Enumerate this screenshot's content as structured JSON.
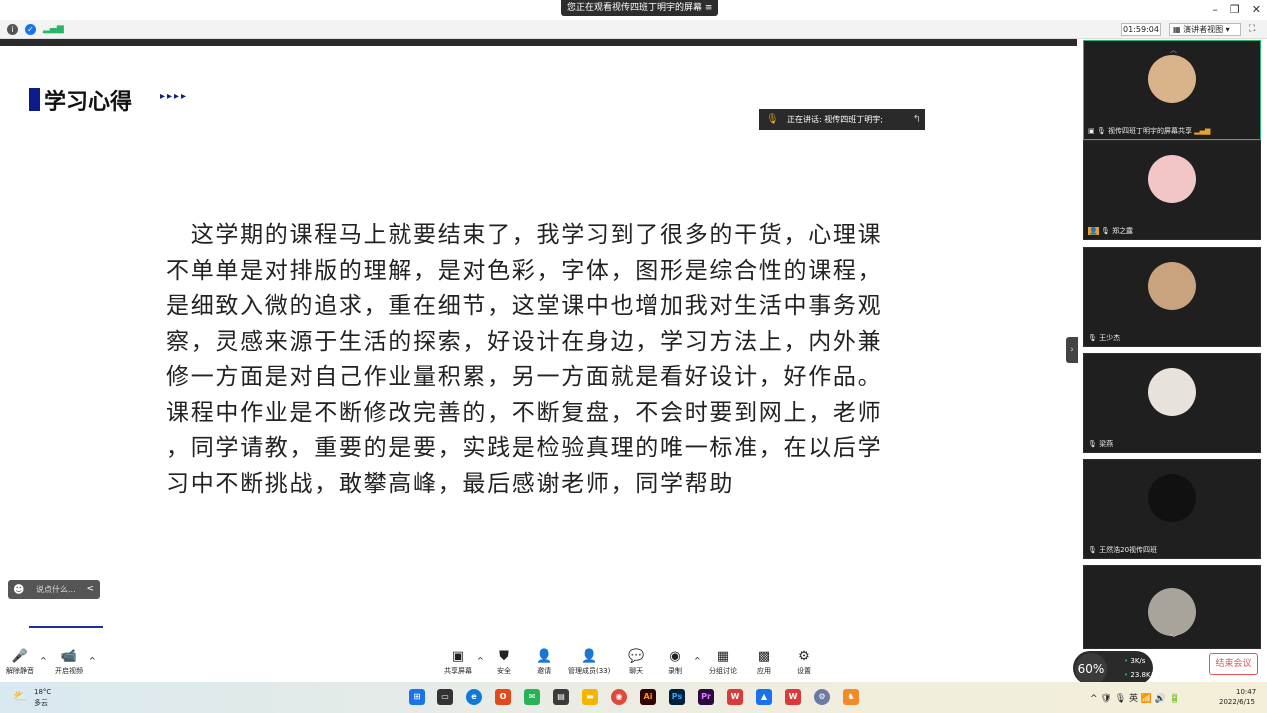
{
  "window": {
    "share_banner": "您正在观看视传四班丁明宇的屏幕",
    "share_banner_icon": "≡",
    "controls": [
      "–",
      "❐",
      "✕"
    ]
  },
  "statusbar": {
    "timer": "01:59:04",
    "view_button": "演讲者视图 ▾"
  },
  "slide": {
    "title": "学习心得",
    "title_arrows": "▸▸▸▸",
    "paragraph_lines": [
      "　这学期的课程马上就要结束了，我学习到了很多的干货，心理课",
      "不单单是对排版的理解，是对色彩，字体，图形是综合性的课程，",
      "是细致入微的追求，重在细节，这堂课中也增加我对生活中事务观",
      "察，灵感来源于生活的探索，好设计在身边，学习方法上，内外兼",
      "修一方面是对自己作业量积累，另一方面就是看好设计，好作品。",
      "课程中作业是不断修改完善的，不断复盘，不会时要到网上，老师",
      "，同学请教，重要的是要，实践是检验真理的唯一标准，在以后学",
      "习中不断挑战，敢攀高峰，最后感谢老师，同学帮助"
    ]
  },
  "speaking": {
    "label": "正在讲话: 视传四班丁明宇;"
  },
  "comment": {
    "placeholder": "说点什么...",
    "collapse": "<"
  },
  "participants": [
    {
      "name": "视传四班丁明宇的屏幕共享",
      "color": "#d9b48a",
      "active": true
    },
    {
      "name": "郑之露",
      "color": "#f2c6c6",
      "active": false
    },
    {
      "name": "王少杰",
      "color": "#c9a27e",
      "active": false
    },
    {
      "name": "梁燕",
      "color": "#e7e2dc",
      "active": false
    },
    {
      "name": "王然浩20视传四班",
      "color": "#111111",
      "active": false
    },
    {
      "name": "",
      "color": "#a9a49b",
      "active": false
    }
  ],
  "toolbar": {
    "left": [
      {
        "label": "解除静音",
        "icon": "🎤"
      },
      {
        "label": "开启视频",
        "icon": "📹"
      }
    ],
    "center": [
      {
        "label": "共享屏幕",
        "icon": "▣"
      },
      {
        "label": "安全",
        "icon": "⛊"
      },
      {
        "label": "邀请",
        "icon": "👤"
      },
      {
        "label": "管理成员(33)",
        "icon": "👤"
      },
      {
        "label": "聊天",
        "icon": "💬"
      },
      {
        "label": "录制",
        "icon": "◉"
      },
      {
        "label": "分组讨论",
        "icon": "▦"
      },
      {
        "label": "应用",
        "icon": "▩"
      },
      {
        "label": "设置",
        "icon": "⚙"
      }
    ],
    "end_meeting": "结束会议"
  },
  "network": {
    "percent": "60%",
    "upload": "3K/s",
    "download": "23.8K/s"
  },
  "taskbar": {
    "weather_temp": "18°C",
    "weather_desc": "多云",
    "tray_text": "^ 🛡 🎙 英 📶 🔊 🔋",
    "time": "10:47",
    "date": "2022/6/15"
  }
}
